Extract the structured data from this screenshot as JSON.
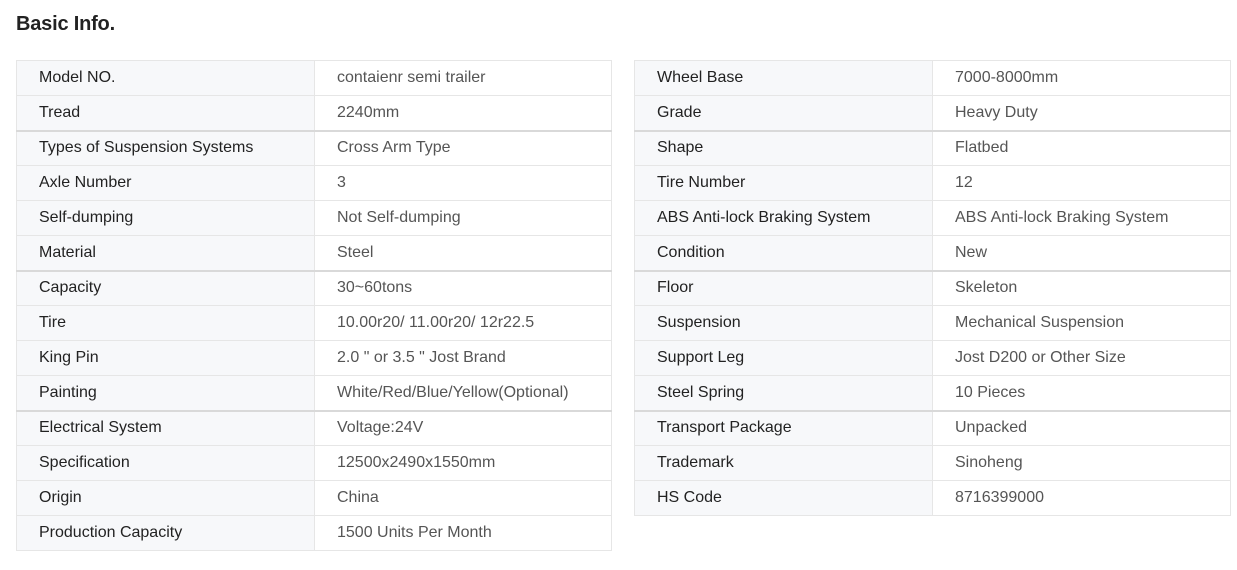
{
  "title": "Basic Info.",
  "left_table": [
    {
      "key": "Model NO.",
      "value": "contaienr semi trailer"
    },
    {
      "key": "Tread",
      "value": "2240mm"
    },
    {
      "key": "Types of Suspension Systems",
      "value": "Cross Arm Type"
    },
    {
      "key": "Axle Number",
      "value": "3"
    },
    {
      "key": "Self-dumping",
      "value": "Not Self-dumping"
    },
    {
      "key": "Material",
      "value": "Steel"
    },
    {
      "key": "Capacity",
      "value": "30~60tons"
    },
    {
      "key": "Tire",
      "value": "10.00r20/ 11.00r20/ 12r22.5"
    },
    {
      "key": "King Pin",
      "value": "2.0 \" or 3.5 \" Jost Brand"
    },
    {
      "key": "Painting",
      "value": "White/Red/Blue/Yellow(Optional)"
    },
    {
      "key": "Electrical System",
      "value": "Voltage:24V"
    },
    {
      "key": "Specification",
      "value": "12500x2490x1550mm"
    },
    {
      "key": "Origin",
      "value": "China"
    },
    {
      "key": "Production Capacity",
      "value": "1500 Units Per Month"
    }
  ],
  "right_table": [
    {
      "key": "Wheel Base",
      "value": "7000-8000mm"
    },
    {
      "key": "Grade",
      "value": "Heavy Duty"
    },
    {
      "key": "Shape",
      "value": "Flatbed"
    },
    {
      "key": "Tire Number",
      "value": "12"
    },
    {
      "key": "ABS Anti-lock Braking System",
      "value": "ABS Anti-lock Braking System"
    },
    {
      "key": "Condition",
      "value": "New"
    },
    {
      "key": "Floor",
      "value": "Skeleton"
    },
    {
      "key": "Suspension",
      "value": "Mechanical Suspension"
    },
    {
      "key": "Support Leg",
      "value": "Jost D200 or Other Size"
    },
    {
      "key": "Steel Spring",
      "value": "10 Pieces"
    },
    {
      "key": "Transport Package",
      "value": "Unpacked"
    },
    {
      "key": "Trademark",
      "value": "Sinoheng"
    },
    {
      "key": "HS Code",
      "value": "8716399000"
    }
  ]
}
